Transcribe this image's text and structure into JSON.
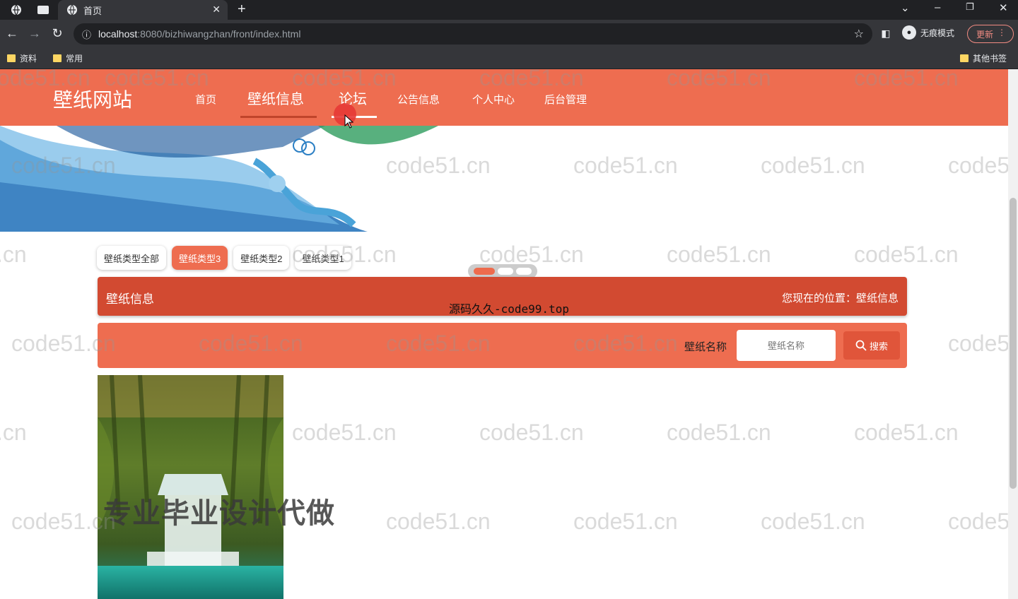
{
  "browser": {
    "tab_title": "首页",
    "url_host": "localhost",
    "url_path": ":8080/bizhiwangzhan/front/index.html",
    "incognito_label": "无痕模式",
    "update_label": "更新",
    "bookmarks": [
      "资料",
      "常用"
    ],
    "other_bookmarks": "其他书签"
  },
  "site": {
    "logo": "壁纸网站",
    "nav": [
      "首页",
      "壁纸信息",
      "论坛",
      "公告信息",
      "个人中心",
      "后台管理"
    ],
    "active_nav_index": 1,
    "categories": [
      "壁纸类型全部",
      "壁纸类型3",
      "壁纸类型2",
      "壁纸类型1"
    ],
    "active_category_index": 1,
    "section_title": "壁纸信息",
    "breadcrumb": "您现在的位置：壁纸信息",
    "search_label": "壁纸名称",
    "search_placeholder": "壁纸名称",
    "search_button": "搜索"
  },
  "overlays": {
    "top_text": "源码久久-code99.top",
    "big_text": "专业毕业设计代做",
    "watermark": "code51.cn"
  },
  "colors": {
    "brand": "#ee6d50",
    "brand_dark": "#d24a31"
  }
}
